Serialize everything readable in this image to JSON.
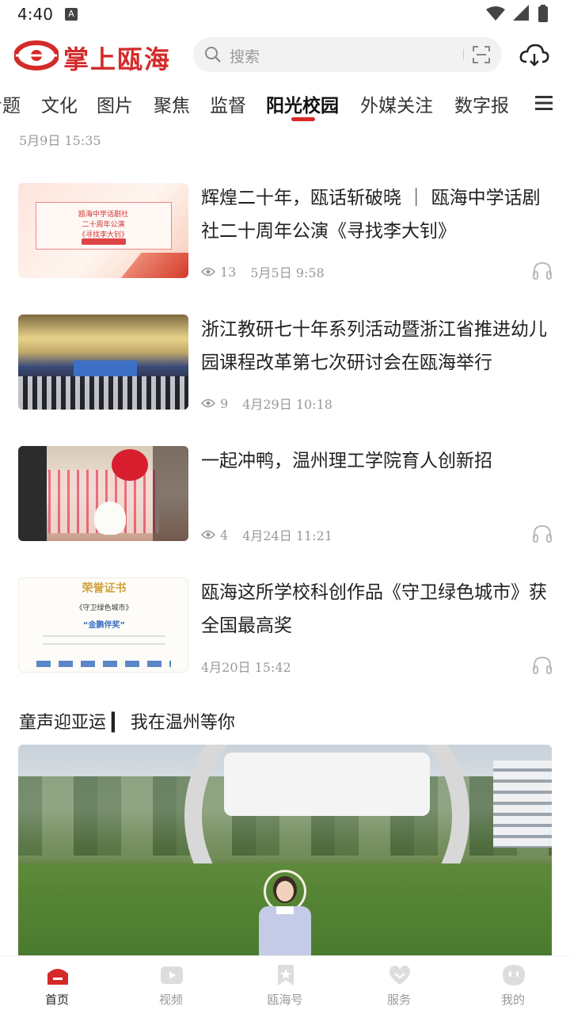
{
  "status_bar": {
    "time": "4:40",
    "notification_letter": "A"
  },
  "header": {
    "logo_text": "掌上瓯海",
    "search_placeholder": "搜索",
    "brand_color": "#d42a2a"
  },
  "tabs": [
    {
      "label": "专题",
      "active": false
    },
    {
      "label": "文化",
      "active": false
    },
    {
      "label": "图片",
      "active": false
    },
    {
      "label": "聚焦",
      "active": false
    },
    {
      "label": "监督",
      "active": false
    },
    {
      "label": "阳光校园",
      "active": true
    },
    {
      "label": "外媒关注",
      "active": false
    },
    {
      "label": "数字报",
      "active": false
    }
  ],
  "top_timestamp": "5月9日 15:35",
  "news": [
    {
      "title": "辉煌二十年，瓯话斩破晓 ｜ 瓯海中学话剧社二十周年公演《寻找李大钊》",
      "views": "13",
      "date": "5月5日 9:58",
      "thumb_text": [
        "瓯海中学话剧社",
        "二十周年公演",
        "《寻找李大钊》"
      ],
      "audio_icon": "headphones-icon"
    },
    {
      "title": "浙江教研七十年系列活动暨浙江省推进幼儿园课程改革第七次研讨会在瓯海举行",
      "views": "9",
      "date": "4月29日 10:18"
    },
    {
      "title": "一起冲鸭，温州理工学院育人创新招",
      "views": "4",
      "date": "4月24日 11:21",
      "audio_icon": "headphones-icon"
    },
    {
      "title": "瓯海这所学校科创作品《守卫绿色城市》获全国最高奖",
      "date": "4月20日 15:42",
      "thumb_text": [
        "荣誉证书",
        "《守卫绿色城市》",
        "“金鹏伴奖”"
      ],
      "audio_icon": "headphones-icon"
    }
  ],
  "section": {
    "title": "童声迎亚运 ▎ 我在温州等你"
  },
  "bottom_nav": [
    {
      "label": "首页",
      "icon": "home-icon",
      "active": true
    },
    {
      "label": "视频",
      "icon": "video-icon",
      "active": false
    },
    {
      "label": "瓯海号",
      "icon": "bookmark-icon",
      "active": false
    },
    {
      "label": "服务",
      "icon": "heart-icon",
      "active": false
    },
    {
      "label": "我的",
      "icon": "profile-icon",
      "active": false
    }
  ]
}
